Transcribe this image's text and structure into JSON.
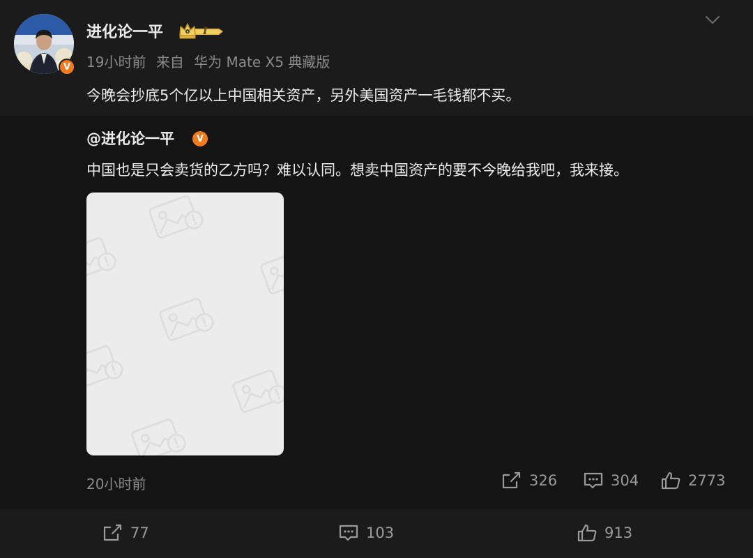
{
  "post": {
    "author": "进化论一平",
    "timestamp": "19小时前",
    "source_prefix": "来自",
    "device": "华为 Mate X5 典藏版",
    "text": "今晚会抄底5个亿以上中国相关资产，另外美国资产一毛钱都不买。",
    "verified_mark": "V",
    "crown_level": "I"
  },
  "repost": {
    "author": "@进化论一平",
    "text": "中国也是只会卖货的乙方吗？难以认同。想卖中国资产的要不今晚给我吧，我来接。",
    "timestamp": "20小时前",
    "stats": {
      "shares": "326",
      "comments": "304",
      "likes": "2773"
    }
  },
  "footer": {
    "shares": "77",
    "comments": "103",
    "likes": "913"
  },
  "icons": {
    "share": "share-icon",
    "comment": "comment-icon",
    "like": "thumbs-up-icon",
    "menu": "chevron-down-icon",
    "verified": "verified-badge-icon",
    "crown": "crown-badge-icon",
    "image": "image-placeholder-icon"
  },
  "colors": {
    "post_bg": "#1b1b1b",
    "repost_bg": "#141414",
    "accent_orange": "#f27a1a",
    "muted_text": "#8a8a8a",
    "text": "#ededed",
    "gold": "#e0b646"
  }
}
